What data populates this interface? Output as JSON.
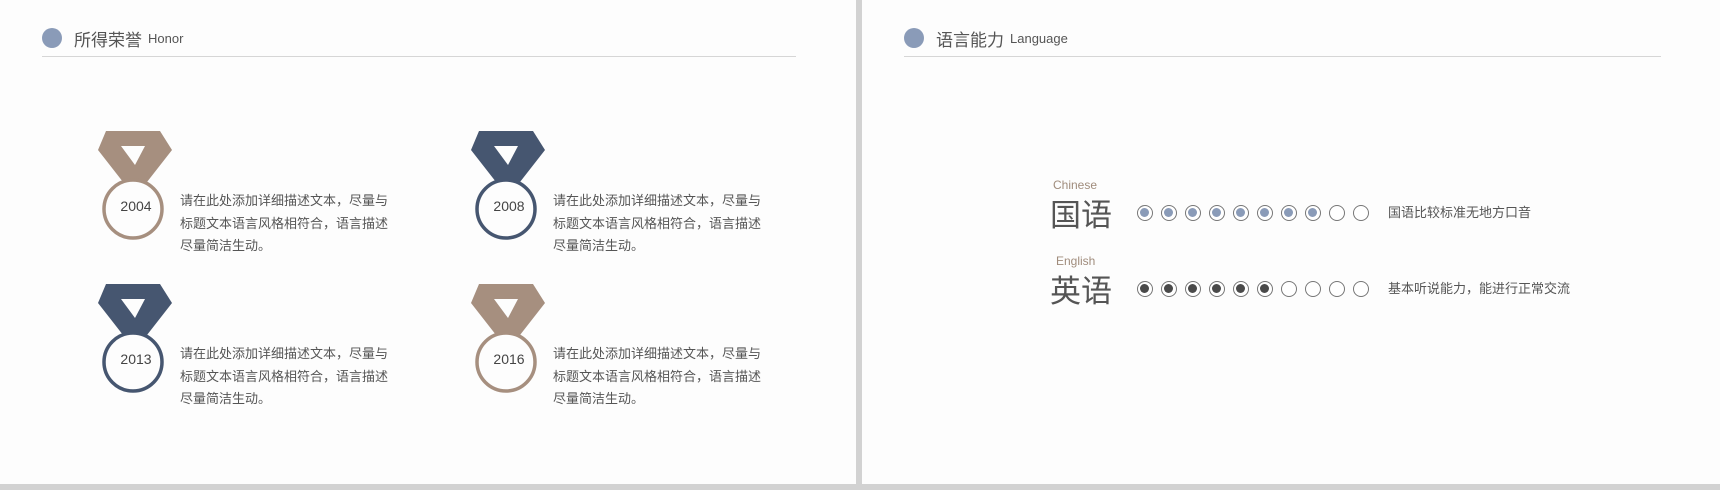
{
  "honor_section": {
    "title": "所得荣誉",
    "subtitle": "Honor",
    "items": [
      {
        "year": "2004",
        "desc": "请在此处添加详细描述文本，尽量与标题文本语言风格相符合，语言描述尽量简洁生动。",
        "color": "#a68f7f"
      },
      {
        "year": "2008",
        "desc": "请在此处添加详细描述文本，尽量与标题文本语言风格相符合，语言描述尽量简洁生动。",
        "color": "#465670"
      },
      {
        "year": "2013",
        "desc": "请在此处添加详细描述文本，尽量与标题文本语言风格相符合，语言描述尽量简洁生动。",
        "color": "#465670"
      },
      {
        "year": "2016",
        "desc": "请在此处添加详细描述文本，尽量与标题文本语言风格相符合，语言描述尽量简洁生动。",
        "color": "#a68f7f"
      }
    ]
  },
  "language_section": {
    "title": "语言能力",
    "subtitle": "Language",
    "languages": [
      {
        "en": "Chinese",
        "zh": "国语",
        "level": 8,
        "max": 10,
        "desc": "国语比较标准无地方口音",
        "dot_color": "#8a9bb8"
      },
      {
        "en": "English",
        "zh": "英语",
        "level": 6,
        "max": 10,
        "desc": "基本听说能力，能进行正常交流",
        "dot_color": "#4a4a4a"
      }
    ]
  },
  "colors": {
    "accent": "#8a9bb8",
    "brown": "#a68f7f",
    "navy": "#465670"
  }
}
